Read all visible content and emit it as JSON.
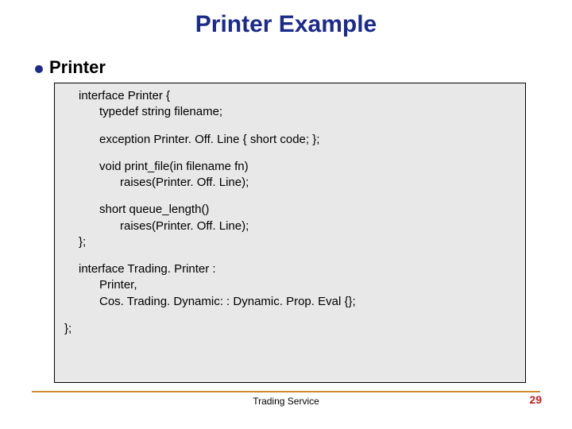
{
  "title": "Printer Example",
  "subtitle": "Printer",
  "code": {
    "l1": "interface Printer {",
    "l2": "typedef string filename;",
    "l3": "exception Printer. Off. Line { short code;  };",
    "l4": "void print_file(in filename fn)",
    "l5": "raises(Printer. Off. Line);",
    "l6": "short queue_length()",
    "l7": "raises(Printer. Off. Line);",
    "l8": "};",
    "l9": "interface Trading. Printer :",
    "l10": "Printer,",
    "l11": "Cos. Trading. Dynamic: : Dynamic. Prop. Eval {};",
    "l12": "};"
  },
  "footer": "Trading Service",
  "page": "29"
}
